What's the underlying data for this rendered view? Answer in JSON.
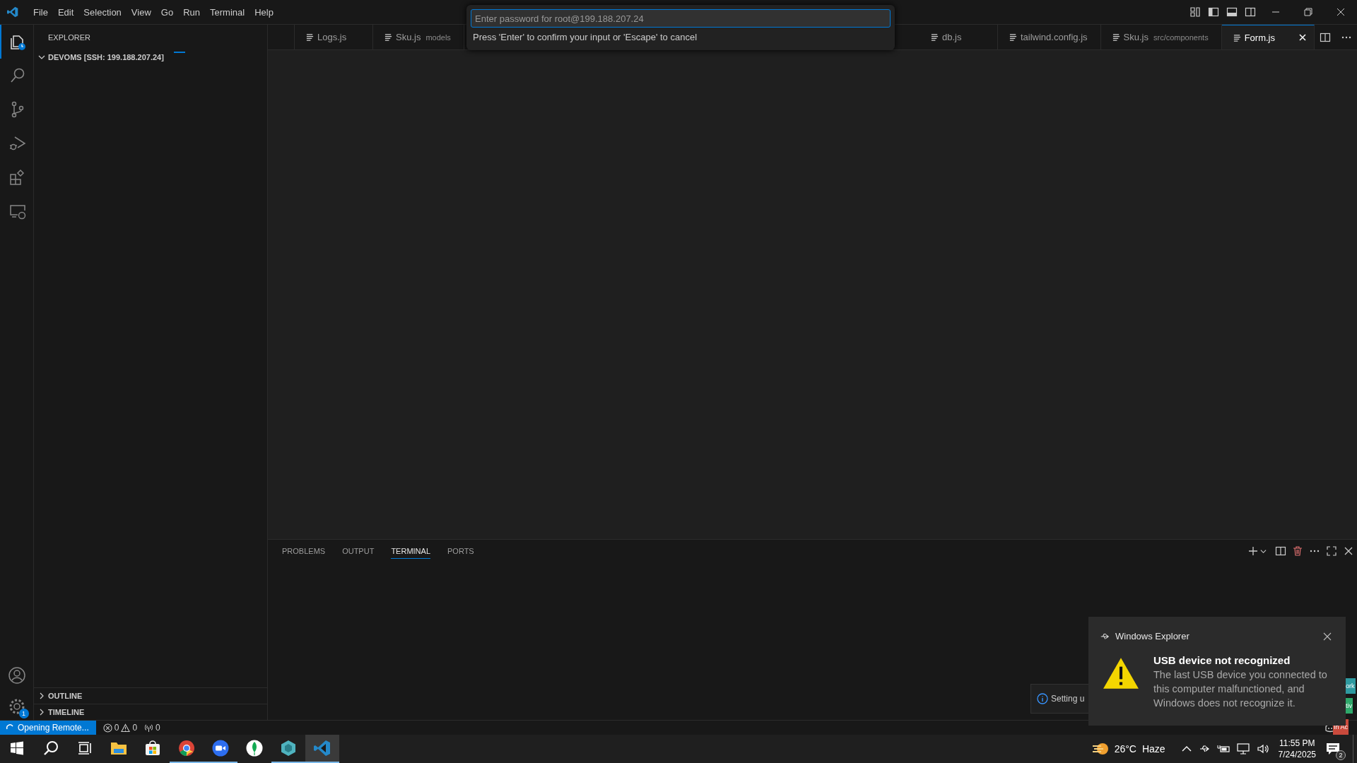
{
  "title_bar": {
    "menu": [
      "File",
      "Edit",
      "Selection",
      "View",
      "Go",
      "Run",
      "Terminal",
      "Help"
    ]
  },
  "activity_bar": {
    "items": [
      {
        "kind": "explorer",
        "selected": true
      },
      {
        "kind": "search",
        "selected": false
      },
      {
        "kind": "source-control",
        "selected": false
      },
      {
        "kind": "run-debug",
        "selected": false
      },
      {
        "kind": "extensions",
        "selected": false
      },
      {
        "kind": "remote",
        "selected": false
      }
    ],
    "settings_badge": "1"
  },
  "sidebar": {
    "title": "EXPLORER",
    "root": {
      "label": "DEVOMS [SSH: 199.188.207.24]",
      "expanded": true
    },
    "sections": [
      {
        "label": "OUTLINE",
        "expanded": false
      },
      {
        "label": "TIMELINE",
        "expanded": false
      }
    ]
  },
  "editor": {
    "tabs": [
      {
        "label": "Logs.js",
        "selected": false
      },
      {
        "label": "Sku.js",
        "description": "models",
        "selected": false
      },
      {
        "label": "db.js",
        "selected": false
      },
      {
        "label": "tailwind.config.js",
        "selected": false
      },
      {
        "label": "Sku.js",
        "description": "src/components",
        "selected": false
      },
      {
        "label": "Form.js",
        "selected": true
      }
    ]
  },
  "quick_input": {
    "placeholder": "Enter password for root@199.188.207.24",
    "message": "Press 'Enter' to confirm your input or 'Escape' to cancel"
  },
  "panel": {
    "tabs": [
      {
        "label": "PROBLEMS",
        "selected": false
      },
      {
        "label": "OUTPUT",
        "selected": false
      },
      {
        "label": "TERMINAL",
        "selected": true
      },
      {
        "label": "PORTS",
        "selected": false
      }
    ]
  },
  "progress_notification": {
    "text": "Setting u"
  },
  "windows_notification": {
    "app": "Windows Explorer",
    "title": "USB device not recognized",
    "body": "The last USB device you connected to this computer malfunctioned, and Windows does not recognize it."
  },
  "edge_fragments": [
    {
      "text": "ork",
      "color": "#2e9aa0"
    },
    {
      "text": "tiv",
      "color": "#2ea86a"
    },
    {
      "text": "In Ac",
      "color": "#c94a3c"
    }
  ],
  "status_bar": {
    "remote": "Opening Remote...",
    "errors": "0",
    "warnings": "0",
    "ports": "0"
  },
  "taskbar": {
    "apps": [
      {
        "kind": "start",
        "running": false,
        "selected": false
      },
      {
        "kind": "search",
        "running": false,
        "selected": false
      },
      {
        "kind": "task-view",
        "running": false,
        "selected": false
      },
      {
        "kind": "file-explorer",
        "running": false,
        "selected": false
      },
      {
        "kind": "store",
        "running": false,
        "selected": false
      },
      {
        "kind": "chrome",
        "running": true,
        "selected": false
      },
      {
        "kind": "zoom",
        "running": true,
        "selected": false
      },
      {
        "kind": "leaf",
        "running": false,
        "selected": false
      },
      {
        "kind": "hexagon",
        "running": true,
        "selected": false
      },
      {
        "kind": "vscode",
        "running": true,
        "selected": true
      }
    ],
    "temperature": "26°C",
    "weather": "Haze",
    "time": "11:55 PM",
    "date": "7/24/2025",
    "notification_count": "2"
  }
}
